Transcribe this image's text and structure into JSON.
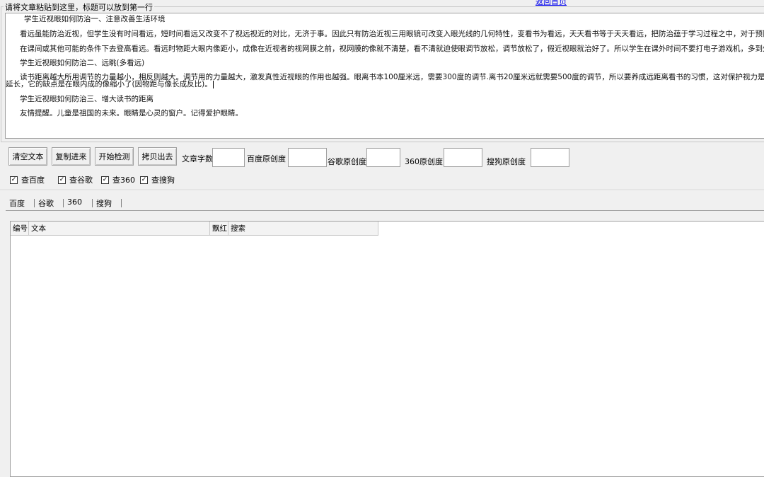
{
  "top_link": "返回首页",
  "editor": {
    "legend": "请将文章粘贴到这里，标题可以放到第一行",
    "lines": [
      "学生近视眼如何防治一、注意改善生活环境",
      "看远虽能防治近视，但学生没有时间看远，短时间看远又改变不了视远视近的对比，无济于事。因此只有防治近视三用眼镜可改变入眼光线的几何特性，变看书为看远，天天看书等于天天看远，把防治蕴于学习过程之中，对于预防学生",
      "在课间或其他可能的条件下去登高看远。看远时物距大眼内像距小，成像在近视者的视网膜之前，视网膜的像就不清楚，看不清就迫使眼调节放松，调节放松了，假近视眼就治好了。所以学生在课外时间不要打电子游戏机，多到外边旅",
      "学生近视眼如何防治二、远眺(多看远)",
      "读书距离越大所用调节的力量越小，相反则越大。调节用的力量越大，激发真性近视眼的作用也越强。眼离书本100厘米远，需要300度的调节.离书20厘米远就需要500度的调节，所以要养成远距离看书的习惯，这对保护视力是很有好处",
      "延长，它的缺点是在眼内成的像缩小了(因物距与像长成反比)。",
      "学生近视眼如何防治三、增大读书的距离",
      "友情提醒。儿童是祖国的未来。眼睛是心灵的窗户。记得爱护眼睛。"
    ]
  },
  "toolbar": {
    "clear_label": "清空文本",
    "copy_in_label": "复制进来",
    "start_label": "开始检测",
    "copy_out_label": "拷贝出去",
    "word_count_label": "文章字数",
    "baidu_orig_label": "百度原创度",
    "google_orig_label": "谷歌原创度",
    "s360_orig_label": "360原创度",
    "sogou_orig_label": "搜狗原创度",
    "word_count_value": "",
    "baidu_value": "",
    "google_value": "",
    "s360_value": "",
    "sogou_value": ""
  },
  "checks": [
    {
      "label": "查百度",
      "checked": true
    },
    {
      "label": "查谷歌",
      "checked": true
    },
    {
      "label": "查360",
      "checked": true
    },
    {
      "label": "查搜狗",
      "checked": true
    }
  ],
  "tabs": [
    "百度",
    "谷歌",
    "360",
    "搜狗"
  ],
  "table": {
    "columns": [
      "编号",
      "文本",
      "飘红",
      "搜索"
    ],
    "rows": []
  },
  "icons": {
    "checkmark": "check-icon",
    "caret": "text-caret"
  }
}
